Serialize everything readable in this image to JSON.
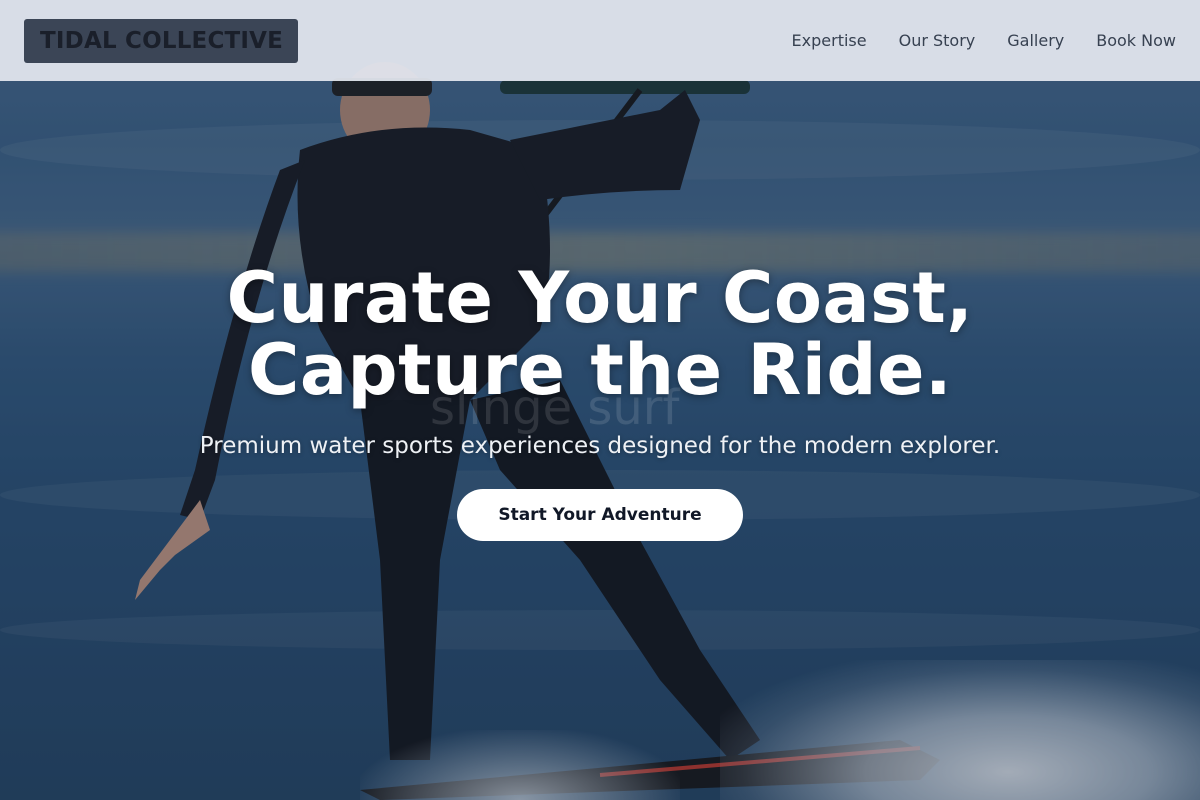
{
  "brand": {
    "logo_text": "TIDAL COLLECTIVE"
  },
  "nav": {
    "items": [
      {
        "label": "Expertise"
      },
      {
        "label": "Our Story"
      },
      {
        "label": "Gallery"
      },
      {
        "label": "Book Now"
      }
    ]
  },
  "hero": {
    "headline_line1": "Curate Your Coast,",
    "headline_line2": "Capture the Ride.",
    "subheadline": "Premium water sports experiences designed for the modern explorer.",
    "cta_label": "Start Your Adventure",
    "background_watermark": "slinge surf"
  },
  "colors": {
    "nav_bg": "#e2e6ee",
    "logo_bg": "#3b4556",
    "logo_text": "#1a1f2a",
    "nav_text": "#374151",
    "cta_bg": "#ffffff",
    "cta_text": "#111827",
    "water": "#2e5478"
  }
}
